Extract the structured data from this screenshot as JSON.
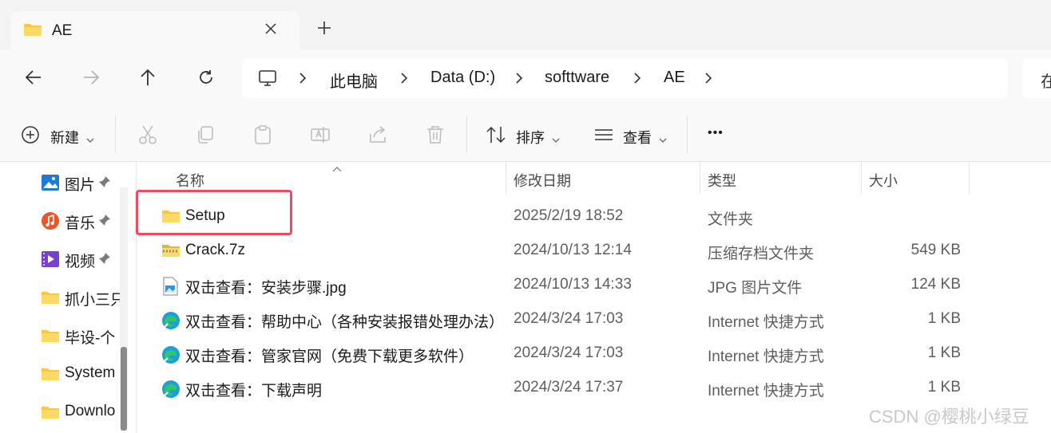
{
  "tab": {
    "title": "AE"
  },
  "breadcrumbs": [
    "此电脑",
    "Data (D:)",
    "softtware",
    "AE"
  ],
  "search": {
    "partial_text": "在"
  },
  "toolbar": {
    "new_label": "新建",
    "sort_label": "排序",
    "view_label": "查看",
    "more_label": "•••"
  },
  "sidebar": {
    "items": [
      {
        "label": "图片",
        "icon": "pictures-icon",
        "pinned": true
      },
      {
        "label": "音乐",
        "icon": "music-icon",
        "pinned": true
      },
      {
        "label": "视频",
        "icon": "video-icon",
        "pinned": true
      },
      {
        "label": "抓小三只",
        "icon": "folder-icon",
        "pinned": false
      },
      {
        "label": "毕设-个",
        "icon": "folder-icon",
        "pinned": false
      },
      {
        "label": "System",
        "icon": "folder-icon",
        "pinned": false
      },
      {
        "label": "Downlo",
        "icon": "folder-icon",
        "pinned": false
      }
    ]
  },
  "columns": {
    "name": "名称",
    "modified": "修改日期",
    "type": "类型",
    "size": "大小"
  },
  "files": [
    {
      "name": "Setup",
      "modified": "2025/2/19 18:52",
      "type": "文件夹",
      "size": "",
      "icon": "folder-icon"
    },
    {
      "name": "Crack.7z",
      "modified": "2024/10/13 12:14",
      "type": "压缩存档文件夹",
      "size": "549 KB",
      "icon": "zip-folder-icon"
    },
    {
      "name": "双击查看：安装步骤.jpg",
      "modified": "2024/10/13 14:33",
      "type": "JPG 图片文件",
      "size": "124 KB",
      "icon": "image-file-icon"
    },
    {
      "name": "双击查看：帮助中心（各种安装报错处理办法）",
      "modified": "2024/3/24 17:03",
      "type": "Internet 快捷方式",
      "size": "1 KB",
      "icon": "edge-shortcut-icon"
    },
    {
      "name": "双击查看：管家官网（免费下载更多软件）",
      "modified": "2024/3/24 17:03",
      "type": "Internet 快捷方式",
      "size": "1 KB",
      "icon": "edge-shortcut-icon"
    },
    {
      "name": "双击查看：下载声明",
      "modified": "2024/3/24 17:37",
      "type": "Internet 快捷方式",
      "size": "1 KB",
      "icon": "edge-shortcut-icon"
    }
  ],
  "watermark": "CSDN @樱桃小绿豆",
  "colors": {
    "highlight": "#ee4b61",
    "folder": "#f7c843",
    "accent": "#0067c0"
  }
}
